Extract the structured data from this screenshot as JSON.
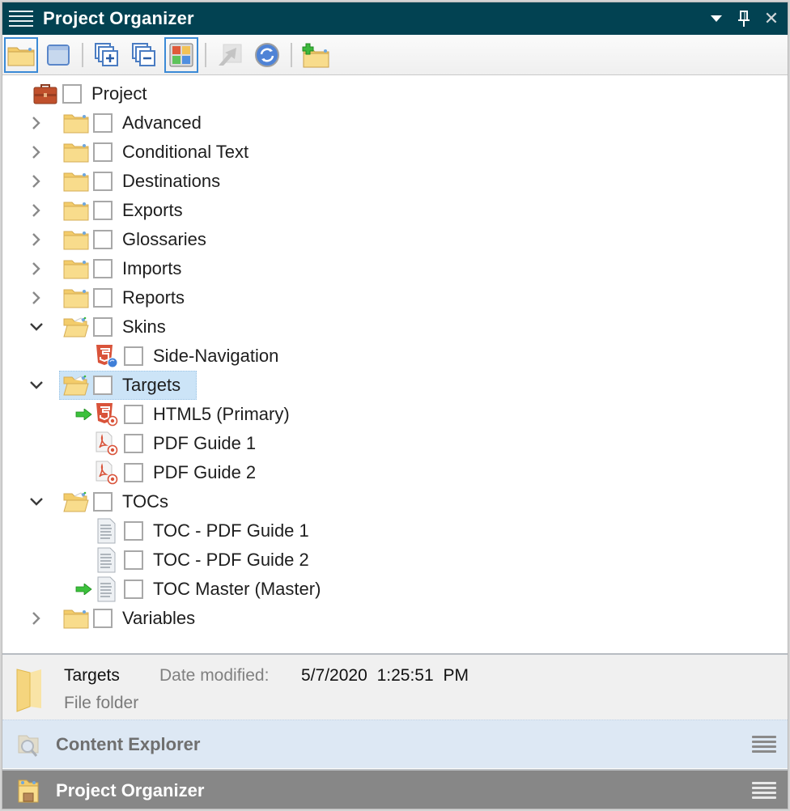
{
  "window": {
    "title": "Project Organizer",
    "actions": {
      "dropdown": "dropdown-triangle",
      "pin": "pin",
      "close": "close"
    }
  },
  "toolbar": {
    "buttons": [
      {
        "name": "open-folder",
        "tooltip_icon": "folder-icon",
        "active": true
      },
      {
        "name": "view-window",
        "tooltip_icon": "window-icon",
        "active": false
      },
      {
        "name": "expand-all",
        "tooltip_icon": "expand-all-icon",
        "active": false
      },
      {
        "name": "collapse-all",
        "tooltip_icon": "collapse-all-icon",
        "active": false
      },
      {
        "name": "view-tiles",
        "tooltip_icon": "tiles-icon",
        "active": true
      },
      {
        "name": "up-disabled",
        "tooltip_icon": "move-up-icon",
        "active": false
      },
      {
        "name": "refresh",
        "tooltip_icon": "refresh-icon",
        "active": false
      },
      {
        "name": "new-folder",
        "tooltip_icon": "new-folder-icon",
        "active": false
      }
    ]
  },
  "tree": {
    "root": {
      "label": "Project",
      "icon": "briefcase"
    },
    "items": [
      {
        "label": "Advanced",
        "icon": "folder",
        "level": 1,
        "chevron": "collapsed"
      },
      {
        "label": "Conditional Text",
        "icon": "folder",
        "level": 1,
        "chevron": "collapsed"
      },
      {
        "label": "Destinations",
        "icon": "folder",
        "level": 1,
        "chevron": "collapsed"
      },
      {
        "label": "Exports",
        "icon": "folder",
        "level": 1,
        "chevron": "collapsed"
      },
      {
        "label": "Glossaries",
        "icon": "folder",
        "level": 1,
        "chevron": "collapsed"
      },
      {
        "label": "Imports",
        "icon": "folder",
        "level": 1,
        "chevron": "collapsed"
      },
      {
        "label": "Reports",
        "icon": "folder",
        "level": 1,
        "chevron": "collapsed"
      },
      {
        "label": "Skins",
        "icon": "folder-open",
        "level": 1,
        "chevron": "expanded"
      },
      {
        "label": "Side-Navigation",
        "icon": "html5-skin",
        "level": 2
      },
      {
        "label": "Targets",
        "icon": "folder-open",
        "level": 1,
        "chevron": "expanded",
        "selected": true
      },
      {
        "label": "HTML5 (Primary)",
        "icon": "html5-target",
        "level": 2,
        "primary": true
      },
      {
        "label": "PDF Guide 1",
        "icon": "pdf-target",
        "level": 2
      },
      {
        "label": "PDF Guide 2",
        "icon": "pdf-target",
        "level": 2
      },
      {
        "label": "TOCs",
        "icon": "folder-open",
        "level": 1,
        "chevron": "expanded"
      },
      {
        "label": "TOC - PDF Guide 1",
        "icon": "toc",
        "level": 2
      },
      {
        "label": "TOC - PDF Guide 2",
        "icon": "toc",
        "level": 2
      },
      {
        "label": "TOC Master (Master)",
        "icon": "toc",
        "level": 2,
        "primary": true
      },
      {
        "label": "Variables",
        "icon": "folder",
        "level": 1,
        "chevron": "collapsed"
      }
    ]
  },
  "details": {
    "name": "Targets",
    "type": "File folder",
    "date_label": "Date modified:",
    "date_value": "5/7/2020 1:25:51 PM"
  },
  "panels": {
    "content_explorer": {
      "label": "Content Explorer"
    },
    "project_organizer": {
      "label": "Project Organizer"
    }
  },
  "colors": {
    "titlebar": "#024252",
    "selection": "#cce4f7",
    "accent_border": "#3b8ad6",
    "content_explorer_bar": "#dde8f4",
    "project_organizer_bar": "#878787"
  }
}
